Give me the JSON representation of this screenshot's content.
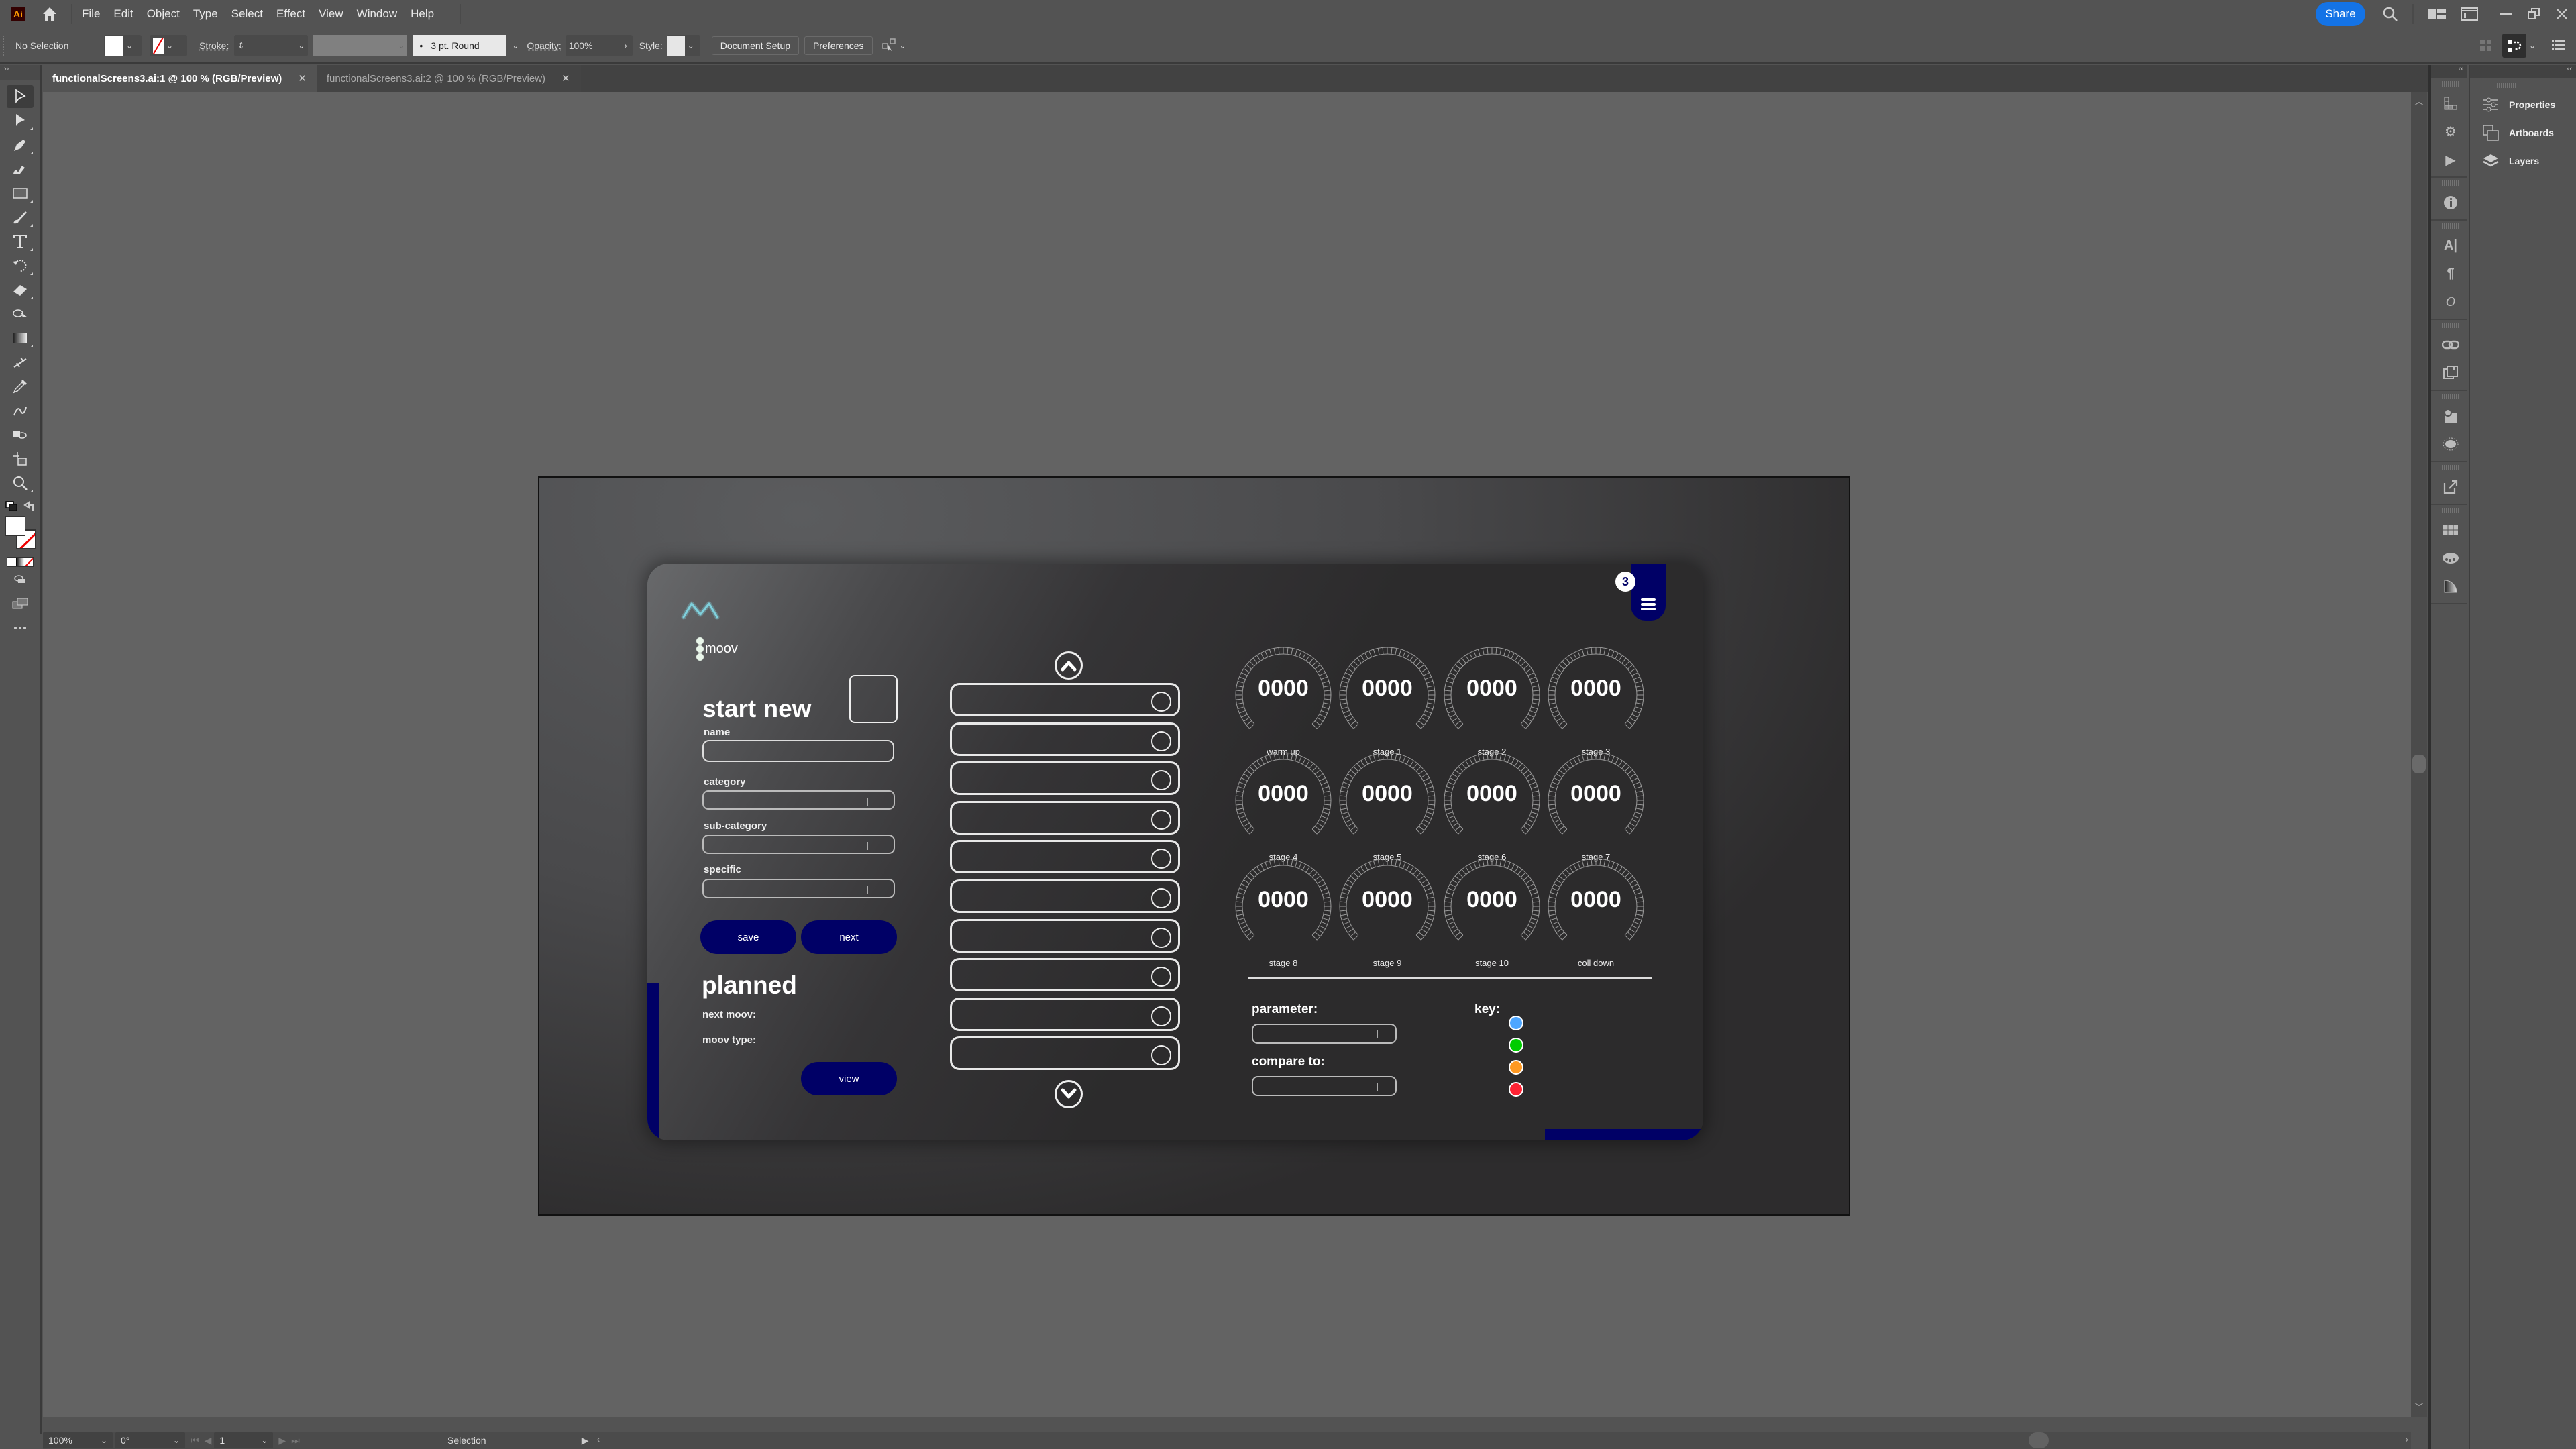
{
  "app": {
    "logo_text": "Ai",
    "menu": [
      "File",
      "Edit",
      "Object",
      "Type",
      "Select",
      "Effect",
      "View",
      "Window",
      "Help"
    ],
    "share_label": "Share"
  },
  "control_bar": {
    "selection_status": "No Selection",
    "stroke_label": "Stroke:",
    "brush_value": "3 pt. Round",
    "opacity_label": "Opacity:",
    "opacity_value": "100%",
    "style_label": "Style:",
    "document_setup_label": "Document Setup",
    "preferences_label": "Preferences"
  },
  "tabs": [
    {
      "label": "functionalScreens3.ai:1 @ 100 % (RGB/Preview)",
      "active": true
    },
    {
      "label": "functionalScreens3.ai:2 @ 100 % (RGB/Preview)",
      "active": false
    }
  ],
  "toolbar": {
    "tools": [
      "selection",
      "direct-selection",
      "pen",
      "curvature",
      "rectangle",
      "paintbrush",
      "type",
      "rotate",
      "eraser",
      "shape-builder",
      "gradient",
      "width",
      "eyedropper",
      "blend",
      "symbol-sprayer",
      "artboard",
      "zoom"
    ]
  },
  "design": {
    "brand_name": "moov",
    "start_new": {
      "title": "start new",
      "fields": [
        {
          "label": "name",
          "type": "text",
          "value": ""
        },
        {
          "label": "category",
          "type": "select",
          "value": ""
        },
        {
          "label": "sub-category",
          "type": "select",
          "value": ""
        },
        {
          "label": "specific",
          "type": "select",
          "value": ""
        }
      ],
      "save_label": "save",
      "next_label": "next"
    },
    "planned": {
      "title": "planned",
      "next_moov_label": "next moov:",
      "moov_type_label": "moov type:",
      "view_label": "view"
    },
    "list_rows": 10,
    "gauges": [
      {
        "value": "0000",
        "label": "warm up"
      },
      {
        "value": "0000",
        "label": "stage 1"
      },
      {
        "value": "0000",
        "label": "stage 2"
      },
      {
        "value": "0000",
        "label": "stage 3"
      },
      {
        "value": "0000",
        "label": "stage 4"
      },
      {
        "value": "0000",
        "label": "stage 5"
      },
      {
        "value": "0000",
        "label": "stage 6"
      },
      {
        "value": "0000",
        "label": "stage 7"
      },
      {
        "value": "0000",
        "label": "stage 8"
      },
      {
        "value": "0000",
        "label": "stage 9"
      },
      {
        "value": "0000",
        "label": "stage 10"
      },
      {
        "value": "0000",
        "label": "coll down"
      }
    ],
    "parameter_label": "parameter:",
    "compare_label": "compare to:",
    "key_label": "key:",
    "key_colors": [
      "#4da6ff",
      "#00cc00",
      "#ff9922",
      "#ff2233"
    ],
    "notification_count": "3",
    "colors": {
      "accent": "#000066",
      "logo": "#7fd0dc"
    }
  },
  "status_bar": {
    "zoom": "100%",
    "rotation": "0°",
    "artboard_number": "1",
    "tool": "Selection"
  },
  "panels": {
    "items": [
      "Properties",
      "Artboards",
      "Layers"
    ]
  }
}
